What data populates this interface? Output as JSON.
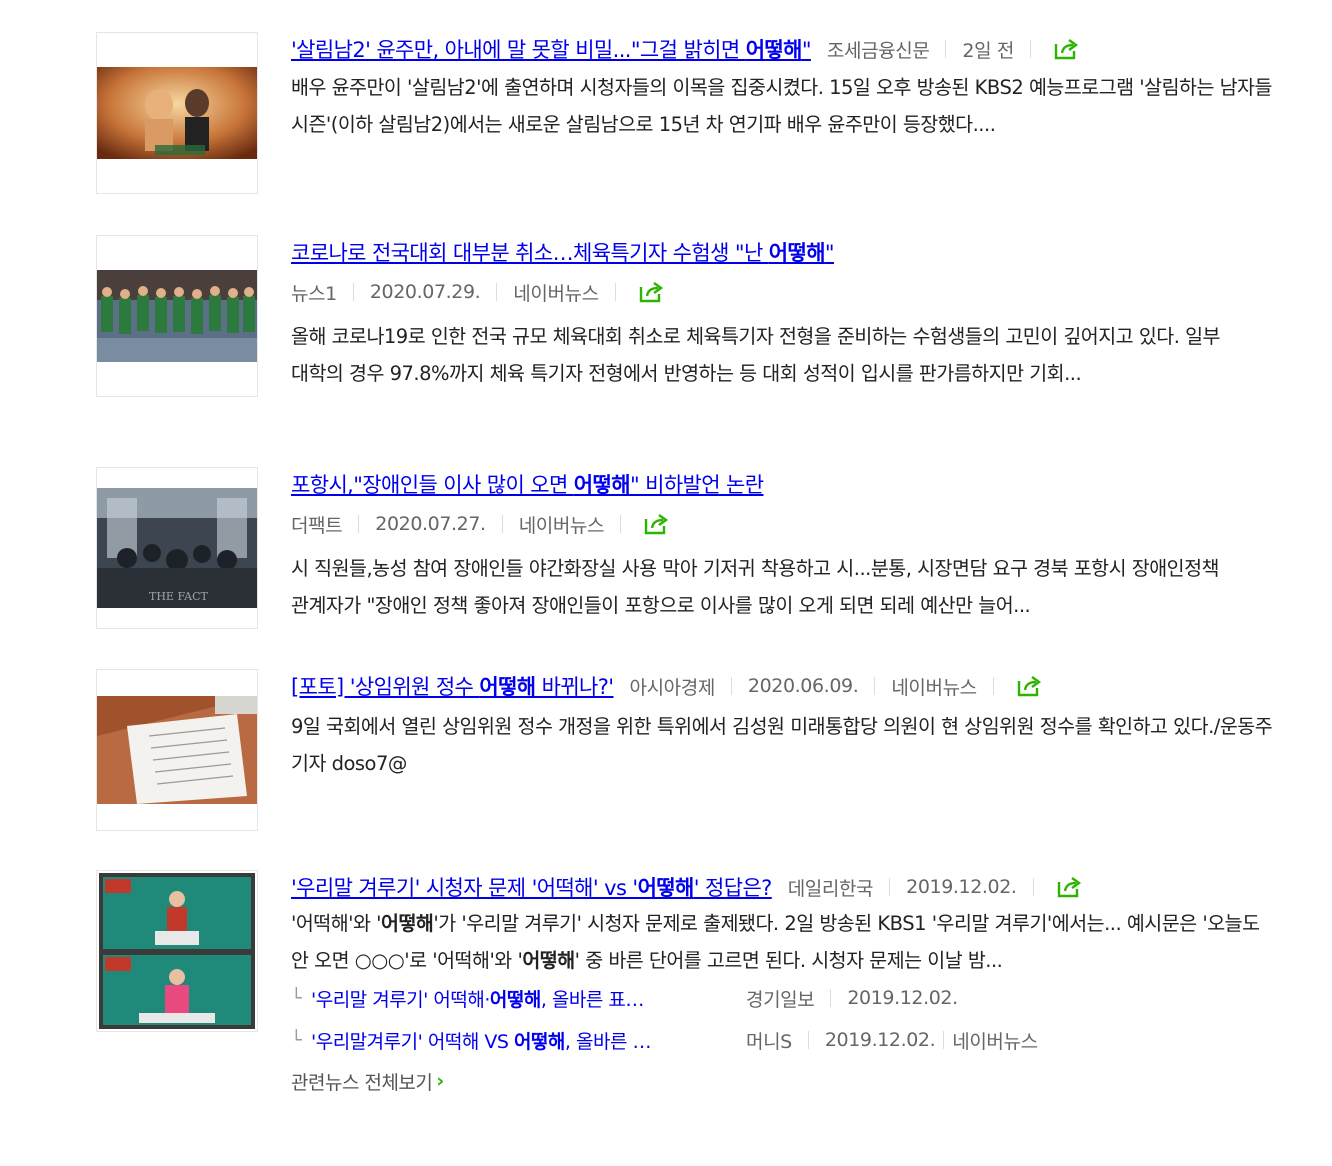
{
  "accent": "#2db400",
  "link_color": "#0000ee",
  "items": [
    {
      "title_pre": "'살림남2' 윤주만, 아내에 말 못할 비밀...\"그걸 밝히면 ",
      "title_kw": "어떻해",
      "title_post": "\"",
      "press": "조세금융신문",
      "date": "2일 전",
      "desc": " 배우 윤주만이 '살림남2'에 출연하며 시청자들의 이목을 집중시켰다. 15일 오후 방송된 KBS2 예능프로그램 '살림하는 남자들 시즌'(이하 살림남2)에서는 새로운 살림남으로 15년 차 연기파 배우 윤주만이 등장했다....",
      "thumb_icon": "tv-show-photo"
    },
    {
      "title_pre": "코로나로 전국대회 대부분 취소…체육특기자 수험생 \"난 ",
      "title_kw": "어떻해",
      "title_post": "\"",
      "press": "뉴스1",
      "date": "2020.07.29.",
      "portal": "네이버뉴스",
      "desc": "올해 코로나19로 인한 전국 규모 체육대회 취소로 체육특기자 전형을 준비하는 수험생들의 고민이 깊어지고 있다. 일부 대학의 경우 97.8%까지 체육 특기자 전형에서 반영하는 등 대회 성적이 입시를 판가름하지만 기회...",
      "thumb_icon": "marathon-photo"
    },
    {
      "title_pre": "포항시,\"장애인들 이사 많이 오면 ",
      "title_kw": "어떻해",
      "title_post": "\" 비하발언 논란",
      "press": "더팩트",
      "date": "2020.07.27.",
      "portal": "네이버뉴스",
      "desc": "시 직원들,농성 참여 장애인들 야간화장실 사용 막아 기저귀 착용하고 시...분통, 시장면담 요구 경북 포항시 장애인정책 관계자가 \"장애인 정책 좋아져 장애인들이 포항으로 이사를 많이 오게 되면 되레 예산만 늘어...",
      "thumb_icon": "protest-photo",
      "thumb_watermark": "THE FACT"
    },
    {
      "title_pre": "[포토] '상임위원 정수 ",
      "title_kw": "어떻해",
      "title_post": " 바뀌나?'",
      "press": "아시아경제",
      "date": "2020.06.09.",
      "portal": "네이버뉴스",
      "desc": "9일 국회에서 열린 상임위원 정수 개정을 위한 특위에서 김성원 미래통합당 의원이 현 상임위원 정수를 확인하고 있다./운동주 기자 doso7@",
      "thumb_icon": "document-photo"
    },
    {
      "title_pre": "'우리말 겨루기' 시청자 문제 '어떡해' vs '",
      "title_kw": "어떻해",
      "title_post": "' 정답은?",
      "press": "데일리한국",
      "date": "2019.12.02.",
      "desc_parts": [
        {
          "t": "'어떡해'와 '"
        },
        {
          "t": "어떻해",
          "b": true
        },
        {
          "t": "'가 '우리말 겨루기' 시청자 문제로 출제됐다. 2일 방송된 KBS1 '우리말 겨루기'에서는... 예시문은 '오늘도 안 오면 ○○○'로 '어떡해'와 '"
        },
        {
          "t": "어떻해",
          "b": true
        },
        {
          "t": "' 중 바른 단어를 고르면 된다. 시청자 문제는 이날 밤..."
        }
      ],
      "thumb_icon": "quiz-show-photo",
      "related": [
        {
          "pre": "'우리말 겨루기' 어떡해·",
          "kw": "어떻해",
          "post": ", 올바른 표…",
          "press": "경기일보",
          "date": "2019.12.02."
        },
        {
          "pre": "'우리말겨루기' 어떡해 VS ",
          "kw": "어떻해",
          "post": ", 올바른 …",
          "press": "머니S",
          "date": "2019.12.02.",
          "portal": "네이버뉴스"
        }
      ],
      "more": "관련뉴스 전체보기",
      "more_chevron": "›"
    }
  ]
}
